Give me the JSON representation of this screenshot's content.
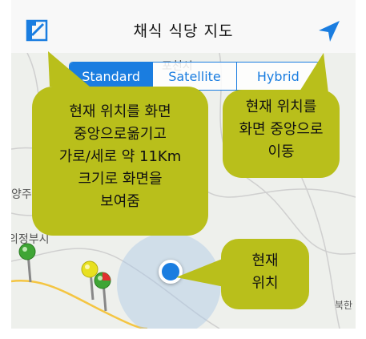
{
  "navbar": {
    "title": "채식 식당 지도",
    "left_icon": "map-edit-icon",
    "right_icon": "location-arrow-icon",
    "accent_color": "#1a7de0"
  },
  "map": {
    "place_labels": [
      "포천시",
      "양주",
      "의정부시",
      "북한"
    ],
    "map_types": [
      {
        "label": "Standard",
        "selected": true
      },
      {
        "label": "Satellite",
        "selected": false
      },
      {
        "label": "Hybrid",
        "selected": false
      }
    ],
    "pin_colors": [
      "#3fa535",
      "#e8e020",
      "#e03030"
    ]
  },
  "callouts": {
    "left": [
      "현재 위치를 화면",
      "중앙으로옮기고",
      "가로/세로 약 11Km",
      "크기로 화면을",
      "보여줌"
    ],
    "right": [
      "현재 위치를",
      "화면 중앙으로",
      "이동"
    ],
    "bottom": [
      "현재",
      "위치"
    ],
    "fill_color": "#b9bf1b"
  }
}
